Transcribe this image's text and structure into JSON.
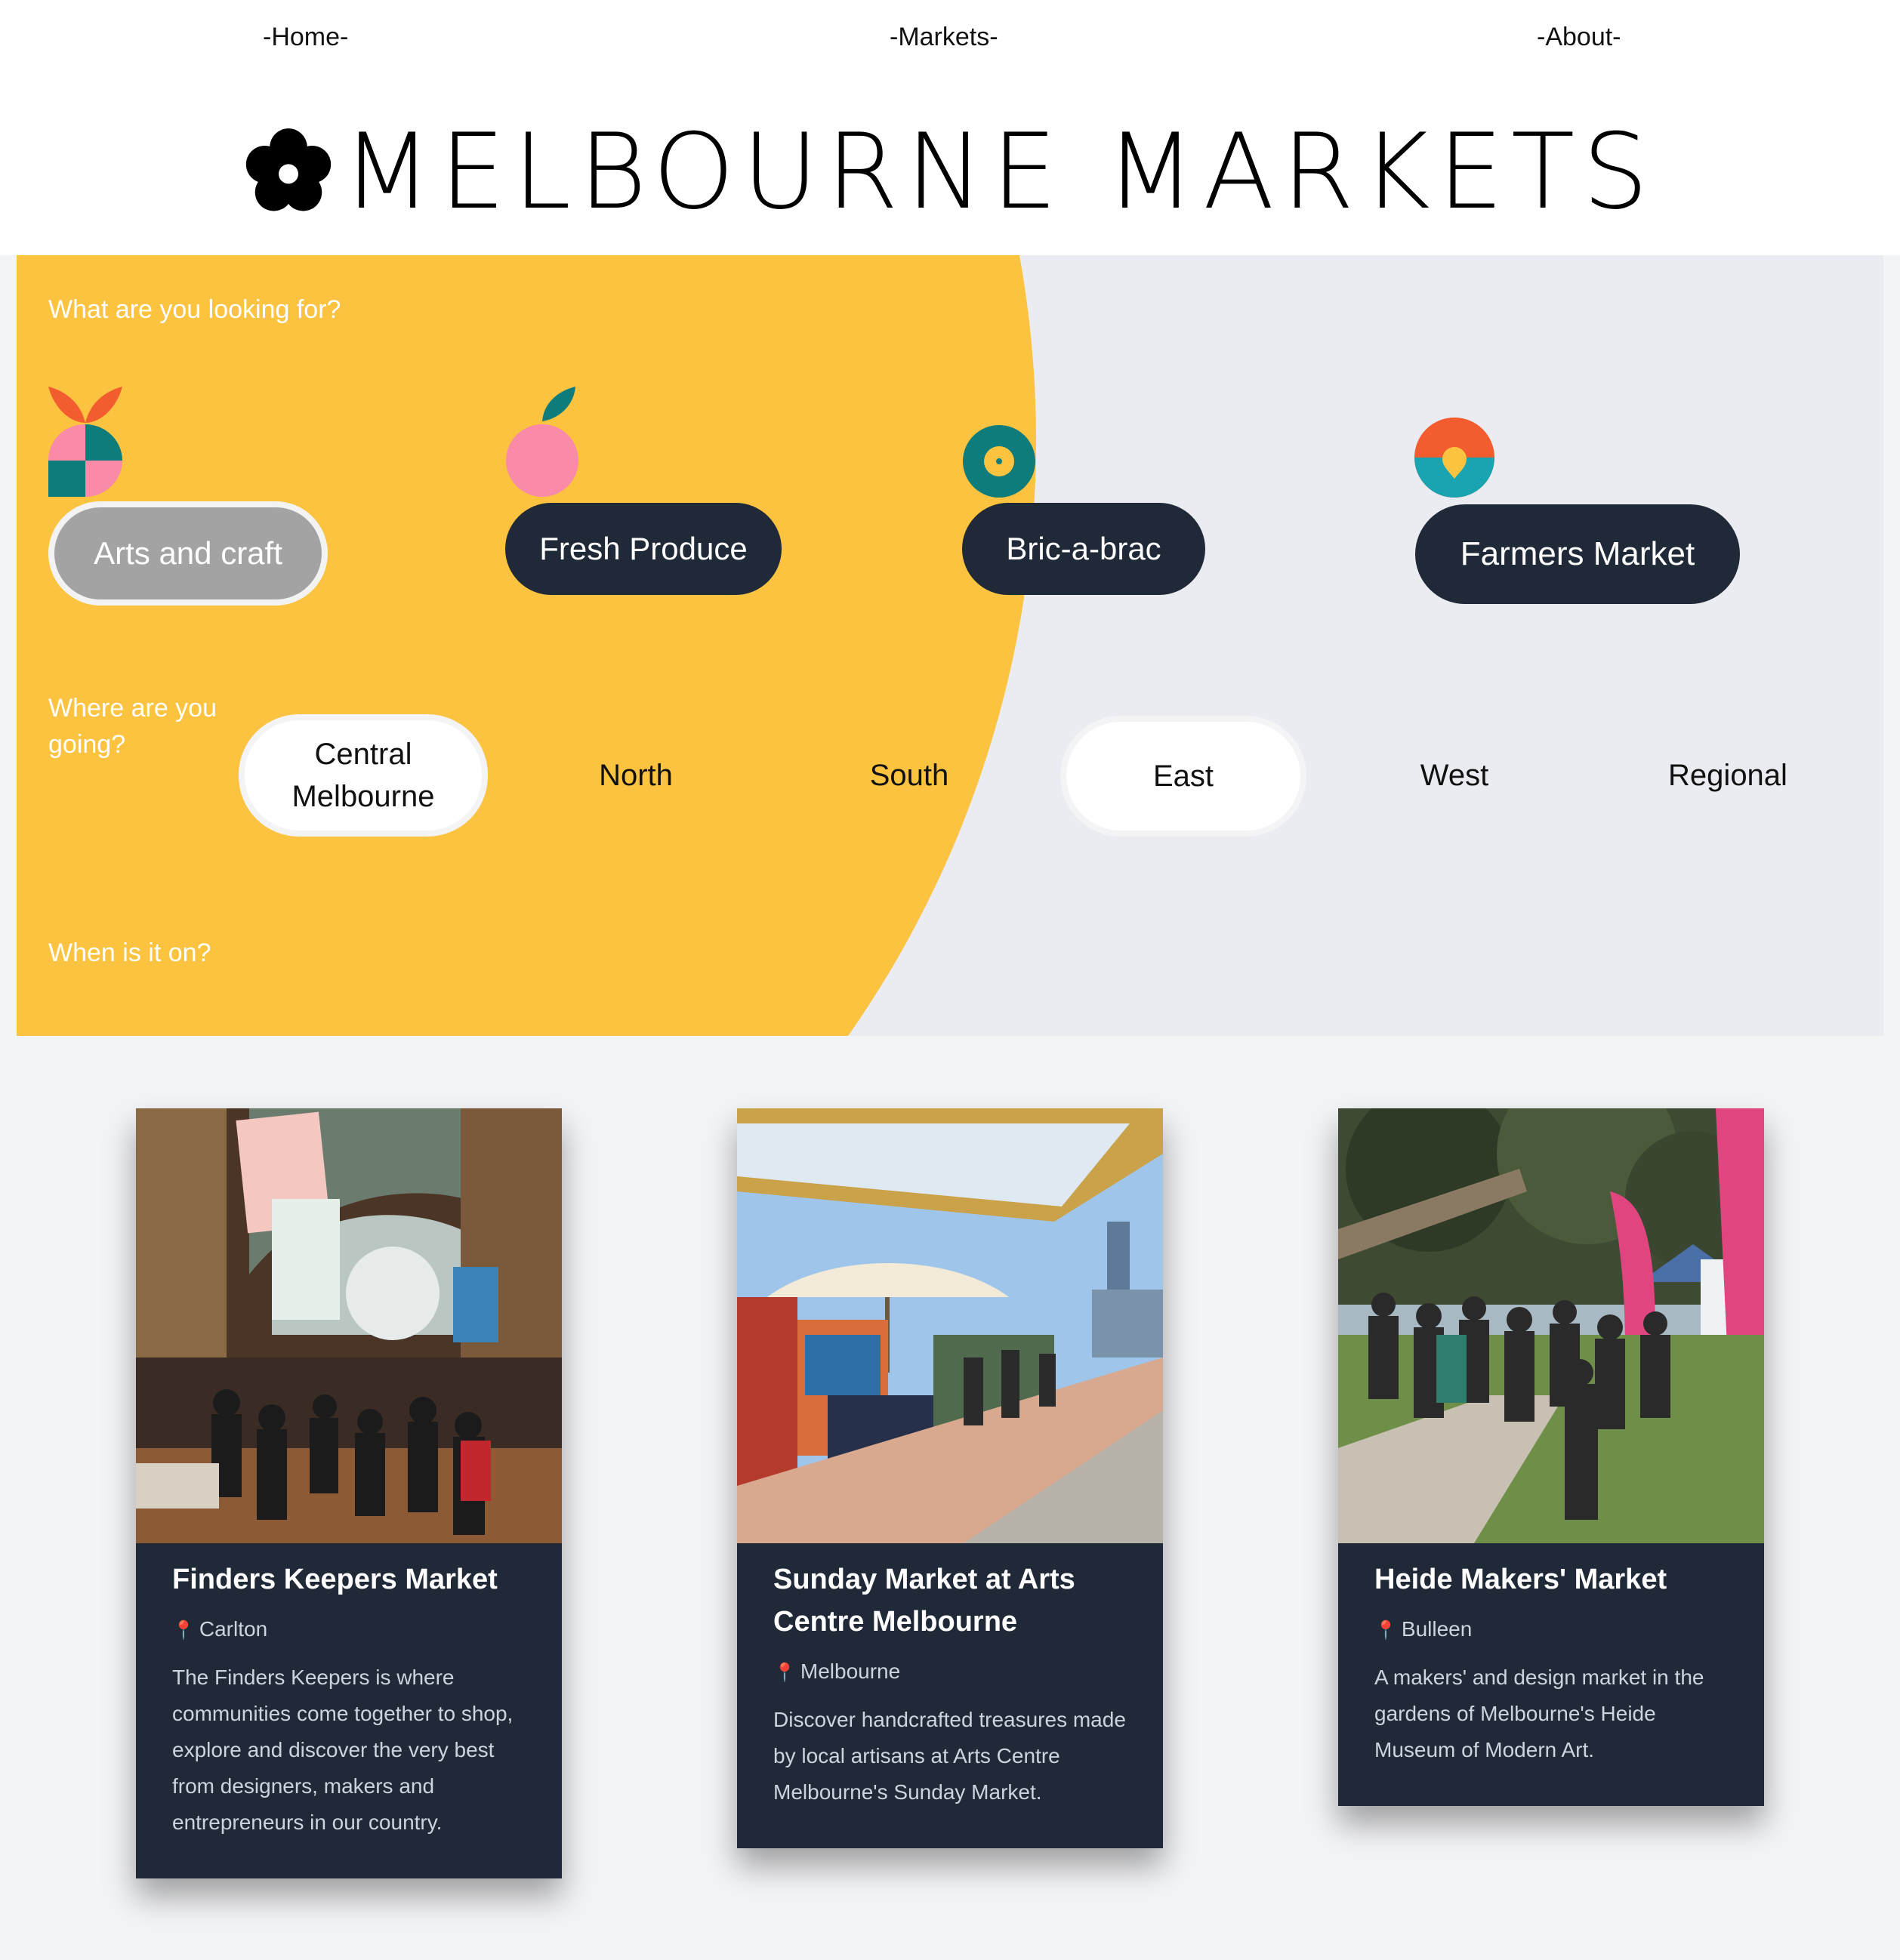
{
  "nav": {
    "home": "-Home-",
    "markets": "-Markets-",
    "about": "-About-"
  },
  "header": {
    "logo_icon": "flower-icon",
    "title": "MELBOURNE MARKETS"
  },
  "filters": {
    "what_question": "What are you looking for?",
    "categories": [
      {
        "label": "Arts and craft",
        "icon": "arts-craft-icon",
        "selected": true
      },
      {
        "label": "Fresh Produce",
        "icon": "apple-icon",
        "selected": false
      },
      {
        "label": "Bric-a-brac",
        "icon": "record-icon",
        "selected": false
      },
      {
        "label": "Farmers Market",
        "icon": "sunrise-icon",
        "selected": false
      }
    ],
    "where_question": "Where are you going?",
    "locations": [
      {
        "label": "Central Melbourne",
        "selected": true
      },
      {
        "label": "North",
        "selected": false
      },
      {
        "label": "South",
        "selected": false
      },
      {
        "label": "East",
        "selected": true
      },
      {
        "label": "West",
        "selected": false
      },
      {
        "label": "Regional",
        "selected": false
      }
    ],
    "when_question": "When is it on?"
  },
  "colors": {
    "sun_yellow": "#fbc340",
    "panel_grey": "#ebecf1",
    "pill_dark": "#1f2937",
    "card_bg": "#1f2937"
  },
  "cards": [
    {
      "title": "Finders Keepers Market",
      "location": "Carlton",
      "pin_icon": "pin-icon",
      "description": "The Finders Keepers is where communities come together to shop, explore and discover the very best from designers, makers and entrepreneurs in our country."
    },
    {
      "title": "Sunday Market at Arts Centre Melbourne",
      "location": "Melbourne",
      "pin_icon": "pin-icon",
      "description": "Discover handcrafted treasures made by local artisans at Arts Centre Melbourne's Sunday Market."
    },
    {
      "title": "Heide Makers' Market",
      "location": "Bulleen",
      "pin_icon": "pin-icon",
      "description": "A makers' and design market in the gardens of Melbourne's Heide Museum of Modern Art."
    }
  ]
}
